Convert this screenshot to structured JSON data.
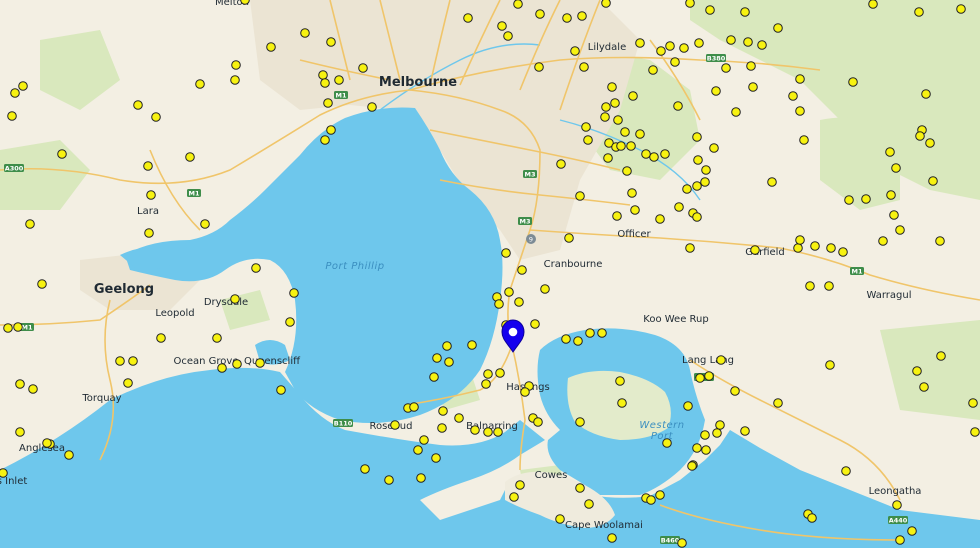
{
  "map": {
    "colors": {
      "land": "#f3efe3",
      "water": "#6ec7ec",
      "park": "#d6e7b8",
      "urban": "#ebe5d6",
      "road": "#f3c970",
      "marker_fill": "#f7f211",
      "pin": "#1500ee"
    },
    "labels": {
      "melbourne": "Melbourne",
      "geelong": "Geelong",
      "melton": "Melton",
      "lilydale": "Lilydale",
      "lara": "Lara",
      "officer": "Officer",
      "cranbourne": "Cranbourne",
      "garfield": "Garfield",
      "warragul": "Warragul",
      "drysdale": "Drysdale",
      "leopold": "Leopold",
      "ocean_grove": "Ocean Grove",
      "queenscliff": "Queenscliff",
      "torquay": "Torquay",
      "anglesea": "Anglesea",
      "inlet": "s Inlet",
      "hastings": "Hastings",
      "koo_wee_rup": "Koo Wee Rup",
      "lang_lang": "Lang Lang",
      "rosebud": "Rosebud",
      "balnarring": "Balnarring",
      "cowes": "Cowes",
      "cape_woolamai": "Cape Woolamai",
      "leongatha": "Leongatha",
      "port_phillip": "Port Phillip",
      "western_port": "Western\nPort"
    },
    "shields": {
      "m1_a": "M1",
      "m1_b": "M1",
      "m1_c": "M1",
      "m1_d": "M1",
      "m3": "M3",
      "m3b": "M3",
      "a300": "A300",
      "b110": "B110",
      "a440": "A440",
      "a440b": "A440",
      "b460": "B460",
      "b380": "B380",
      "nine": "9"
    },
    "selected_pin": "location-pin"
  }
}
